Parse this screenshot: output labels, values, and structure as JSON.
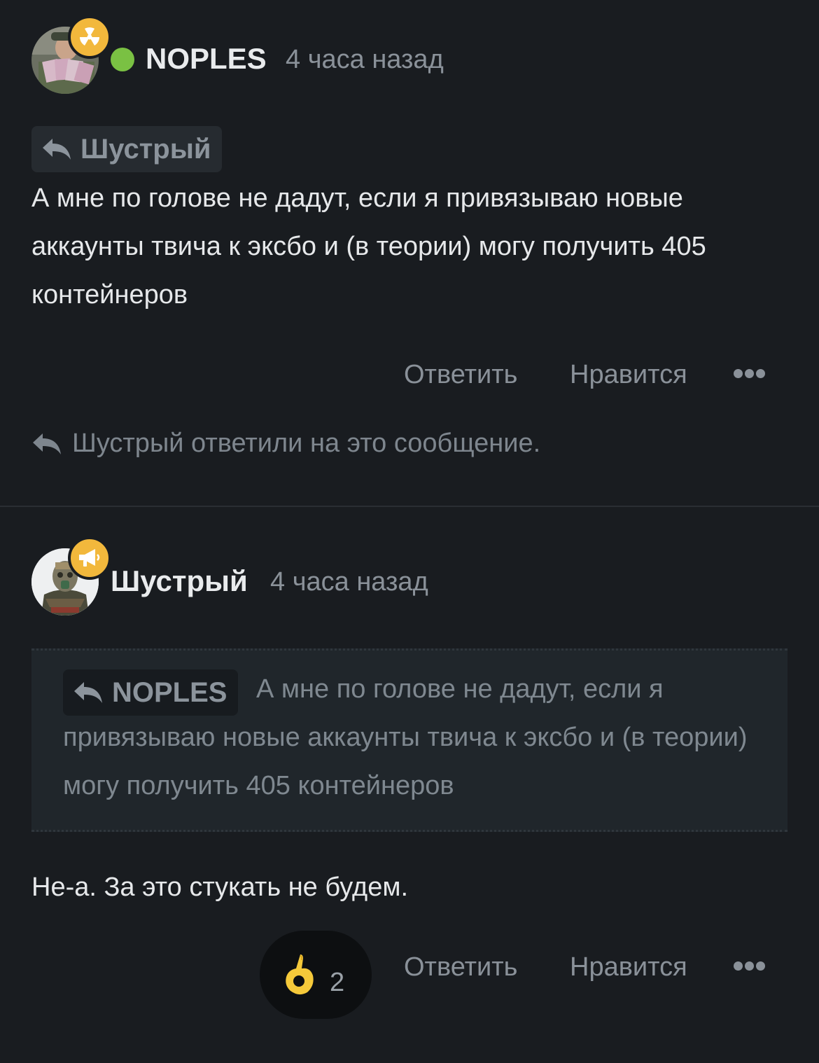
{
  "posts": [
    {
      "author": "NOPLES",
      "time": "4 часа назад",
      "online": true,
      "badge_icon": "radiation-icon",
      "reply_to": "Шустрый",
      "message": "А мне по голове не дадут, если я привязываю новые аккаунты твича к эксбо и (в теории) могу получить 405 контейнеров",
      "actions": {
        "reply": "Ответить",
        "like": "Нравится"
      },
      "replied_note": "Шустрый ответили на это сообщение."
    },
    {
      "author": "Шустрый",
      "time": "4 часа назад",
      "badge_icon": "megaphone-icon",
      "quote": {
        "author": "NOPLES",
        "text": "А мне по голове не дадут, если я привязываю новые аккаунты твича к эксбо и (в теории) могу получить 405 контейнеров"
      },
      "message": "Не-а. За это стукать не будем.",
      "reaction": {
        "emoji": "👌",
        "count": "2"
      },
      "actions": {
        "reply": "Ответить",
        "like": "Нравится"
      }
    }
  ],
  "colors": {
    "background": "#191c20",
    "badge": "#f2b83c",
    "online": "#7ac143",
    "muted_text": "#8a9199"
  }
}
